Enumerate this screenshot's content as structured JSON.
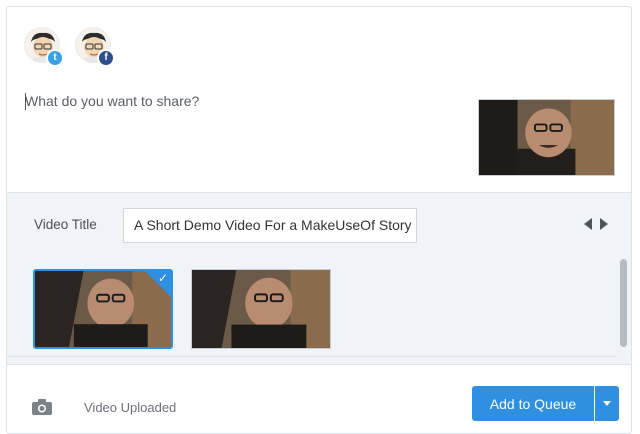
{
  "profiles": [
    {
      "network": "twitter",
      "badge": "t",
      "icon": "twitter-icon"
    },
    {
      "network": "facebook",
      "badge": "f",
      "icon": "facebook-icon"
    }
  ],
  "composer": {
    "placeholder": "What do you want to share?"
  },
  "video": {
    "title_label": "Video Title",
    "title_value": "A Short Demo Video For a MakeUseOf Story",
    "selected_thumbnail": 1
  },
  "footer": {
    "status": "Video Uploaded",
    "queue_button": "Add to Queue"
  },
  "colors": {
    "accent": "#2f8fe0",
    "twitter": "#3aa1e6",
    "facebook": "#2d4f8f"
  }
}
